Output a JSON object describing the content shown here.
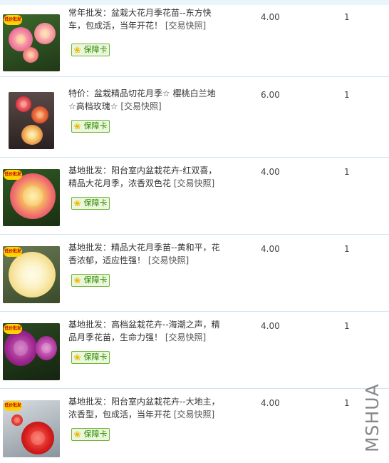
{
  "items": [
    {
      "title": "常年批发：盆栽大花月季花苗--东方快车，包成活，当年开花！",
      "snapshot_label": "[交易快照]",
      "guarantee_label": "保障卡",
      "badge": "低价批发",
      "price": "4.00",
      "quantity": "1"
    },
    {
      "title": "特价：盆栽精品切花月季☆ 樱桃白兰地☆高档玫瑰☆",
      "snapshot_label": "[交易快照]",
      "guarantee_label": "保障卡",
      "badge": "",
      "price": "6.00",
      "quantity": "1"
    },
    {
      "title": "基地批发：阳台室内盆栽花卉-红双喜，精品大花月季，浓香双色花",
      "snapshot_label": "[交易快照]",
      "guarantee_label": "保障卡",
      "badge": "低价批发",
      "price": "4.00",
      "quantity": "1"
    },
    {
      "title": "基地批发：精品大花月季苗--黄和平，花香浓郁，适应性强！",
      "snapshot_label": "[交易快照]",
      "guarantee_label": "保障卡",
      "badge": "低价批发",
      "price": "4.00",
      "quantity": "1"
    },
    {
      "title": "基地批发：高档盆栽花卉--海潮之声，精品月季花苗，生命力强！",
      "snapshot_label": "[交易快照]",
      "guarantee_label": "保障卡",
      "badge": "低价批发",
      "price": "4.00",
      "quantity": "1"
    },
    {
      "title": "基地批发：阳台室内盆栽花卉--大地主，浓香型，包成活，当年开花",
      "snapshot_label": "[交易快照]",
      "guarantee_label": "保障卡",
      "badge": "低价批发",
      "price": "4.00",
      "quantity": "1"
    }
  ],
  "watermark": "MSHUA",
  "colors": {
    "row_separator": "#cfe3f3",
    "guarantee_border": "#72b23d",
    "guarantee_text": "#2e8b00",
    "badge_bg": "#ffd200",
    "badge_text": "#c00000"
  }
}
